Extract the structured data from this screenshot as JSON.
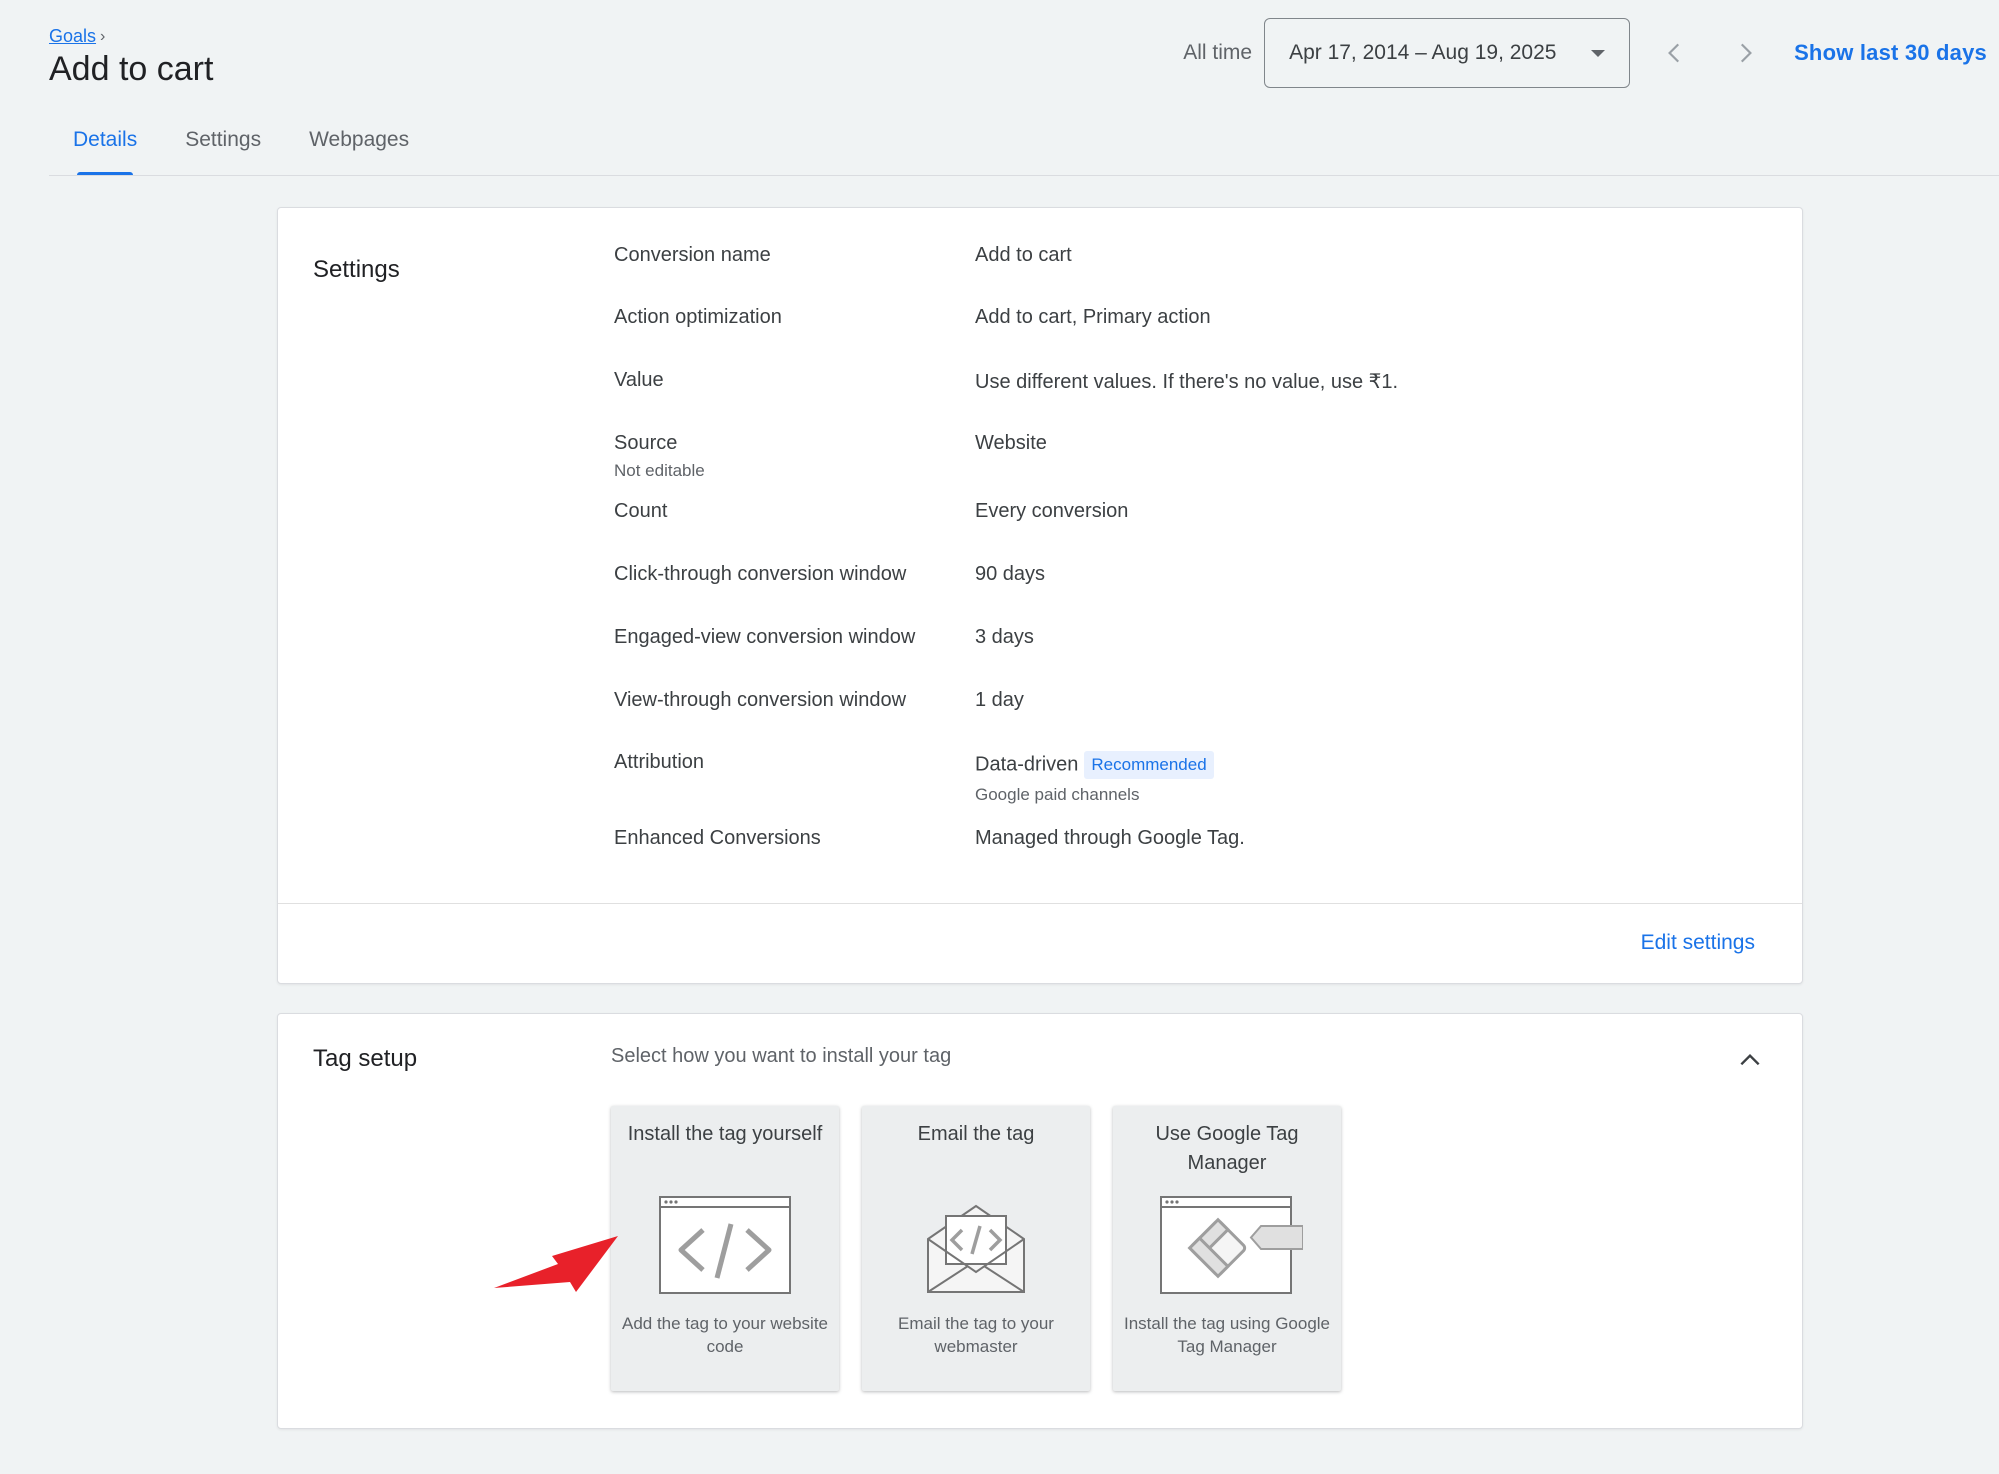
{
  "header": {
    "breadcrumb": "Goals",
    "title": "Add to cart",
    "range_label": "All time",
    "date_range": "Apr 17, 2014 – Aug 19, 2025",
    "show_last": "Show last 30 days"
  },
  "tabs": [
    {
      "label": "Details",
      "active": true
    },
    {
      "label": "Settings",
      "active": false
    },
    {
      "label": "Webpages",
      "active": false
    }
  ],
  "settings": {
    "title": "Settings",
    "rows": [
      {
        "label": "Conversion name",
        "value": "Add to cart"
      },
      {
        "label": "Action optimization",
        "value": "Add to cart, Primary action"
      },
      {
        "label": "Value",
        "value": "Use different values. If there's no value, use ₹1."
      },
      {
        "label": "Source",
        "sub": "Not editable",
        "value": "Website"
      },
      {
        "label": "Count",
        "value": "Every conversion"
      },
      {
        "label": "Click-through conversion window",
        "value": "90 days"
      },
      {
        "label": "Engaged-view conversion window",
        "value": "3 days"
      },
      {
        "label": "View-through conversion window",
        "value": "1 day"
      },
      {
        "label": "Attribution",
        "value": "Data-driven",
        "badge": "Recommended",
        "value_sub": "Google paid channels"
      },
      {
        "label": "Enhanced Conversions",
        "value": "Managed through Google Tag."
      }
    ],
    "edit_label": "Edit settings"
  },
  "tag_setup": {
    "title": "Tag setup",
    "subtitle": "Select how you want to install your tag",
    "options": [
      {
        "title": "Install the tag yourself",
        "description": "Add the tag to your website code",
        "icon": "code-window-icon"
      },
      {
        "title": "Email the tag",
        "description": "Email the tag to your webmaster",
        "icon": "envelope-code-icon"
      },
      {
        "title": "Use Google Tag Manager",
        "description": "Install the tag using Google Tag Manager",
        "icon": "tag-manager-icon"
      }
    ]
  },
  "colors": {
    "accent": "#1a73e8",
    "background": "#f0f3f4",
    "annotation_arrow": "#e8212a"
  }
}
